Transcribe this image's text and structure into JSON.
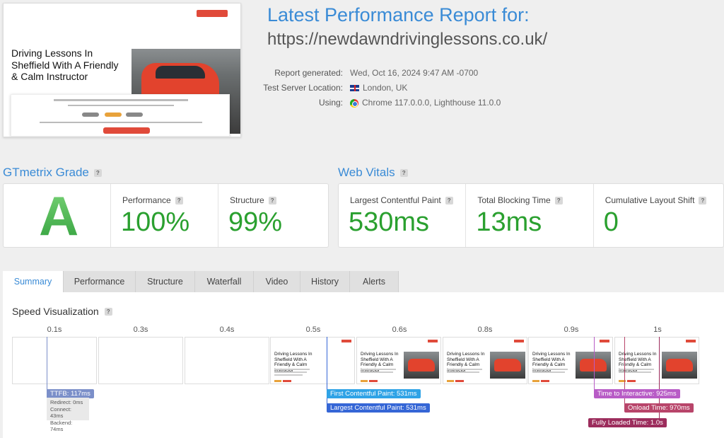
{
  "header": {
    "title": "Latest Performance Report for:",
    "url": "https://newdawndrivinglessons.co.uk/",
    "meta": [
      {
        "key": "Report generated:",
        "value": "Wed, Oct 16, 2024 9:47 AM -0700",
        "icon": ""
      },
      {
        "key": "Test Server Location:",
        "value": "London, UK",
        "icon": "uk-flag-icon"
      },
      {
        "key": "Using:",
        "value": "Chrome 117.0.0.0, Lighthouse 11.0.0",
        "icon": "chrome-icon"
      }
    ]
  },
  "thumbnail": {
    "headline": "Driving Lessons In Sheffield With A Friendly & Calm Instructor"
  },
  "grade": {
    "section_title": "GTmetrix Grade",
    "letter": "A",
    "performance_label": "Performance",
    "performance_value": "100%",
    "structure_label": "Structure",
    "structure_value": "99%"
  },
  "vitals": {
    "section_title": "Web Vitals",
    "lcp_label": "Largest Contentful Paint",
    "lcp_value": "530ms",
    "tbt_label": "Total Blocking Time",
    "tbt_value": "13ms",
    "cls_label": "Cumulative Layout Shift",
    "cls_value": "0"
  },
  "tabs": [
    "Summary",
    "Performance",
    "Structure",
    "Waterfall",
    "Video",
    "History",
    "Alerts"
  ],
  "speed": {
    "title": "Speed Visualization",
    "timeline": [
      "0.1s",
      "0.3s",
      "0.4s",
      "0.5s",
      "0.6s",
      "0.8s",
      "0.9s",
      "1s"
    ],
    "frame_text": "Driving Lessons In Sheffield With A Friendly & Calm Instructor",
    "ttfb": {
      "label": "TTFB: 117ms",
      "redirect": "Redirect: 0ms",
      "connect": "Connect: 43ms",
      "backend": "Backend: 74ms"
    },
    "fcp": "First Contentful Paint: 531ms",
    "lcp": "Largest Contentful Paint: 531ms",
    "tti": "Time to Interactive: 925ms",
    "onload": "Onload Time: 970ms",
    "fully_loaded": "Fully Loaded Time: 1.0s"
  },
  "colors": {
    "accent": "#3a8bd6",
    "good": "#2aa02f",
    "ttfb": "#7b8fc9",
    "fcp": "#2fa3e6",
    "lcp": "#3566d6",
    "tti": "#b85cc6",
    "onload": "#b8456a",
    "fully_loaded": "#9c2c5c"
  }
}
